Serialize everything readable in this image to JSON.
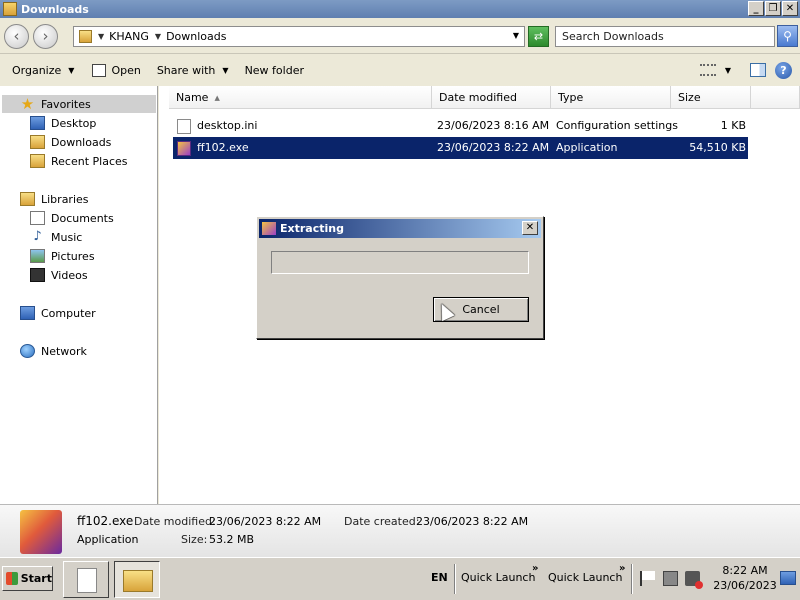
{
  "window": {
    "title": "Downloads",
    "buttons": {
      "minimize": "_",
      "restore": "❐",
      "close": "✕"
    }
  },
  "address": {
    "crumbs": [
      "KHANG",
      "Downloads"
    ],
    "search_placeholder": "Search Downloads"
  },
  "toolbar": {
    "organize": "Organize",
    "open": "Open",
    "share_with": "Share with",
    "new_folder": "New folder"
  },
  "nav": {
    "favorites": "Favorites",
    "desktop": "Desktop",
    "downloads": "Downloads",
    "recent_places": "Recent Places",
    "libraries": "Libraries",
    "documents": "Documents",
    "music": "Music",
    "pictures": "Pictures",
    "videos": "Videos",
    "computer": "Computer",
    "network": "Network"
  },
  "columns": {
    "name": "Name",
    "date_modified": "Date modified",
    "type": "Type",
    "size": "Size"
  },
  "files": [
    {
      "name": "desktop.ini",
      "date": "23/06/2023 8:16 AM",
      "type": "Configuration settings",
      "size": "1 KB",
      "icon": "ini-file-icon"
    },
    {
      "name": "ff102.exe",
      "date": "23/06/2023 8:22 AM",
      "type": "Application",
      "size": "54,510 KB",
      "icon": "app-icon",
      "selected": true
    }
  ],
  "dialog": {
    "title": "Extracting",
    "cancel": "Cancel",
    "close": "✕",
    "progress": 0
  },
  "details": {
    "name": "ff102.exe",
    "date_modified_label": "Date modified:",
    "date_modified": "23/06/2023 8:22 AM",
    "date_created_label": "Date created:",
    "date_created": "23/06/2023 8:22 AM",
    "type": "Application",
    "size_label": "Size:",
    "size": "53.2 MB"
  },
  "taskbar": {
    "start": "Start",
    "lang": "EN",
    "quick_launch_1": "Quick Launch",
    "quick_launch_2": "Quick Launch",
    "chevron": "»",
    "time": "8:22 AM",
    "date": "23/06/2023"
  },
  "colors": {
    "selection": "#0a246a",
    "dialog_bg": "#d4d0c8",
    "title_gradient_start": "#0a246a"
  }
}
